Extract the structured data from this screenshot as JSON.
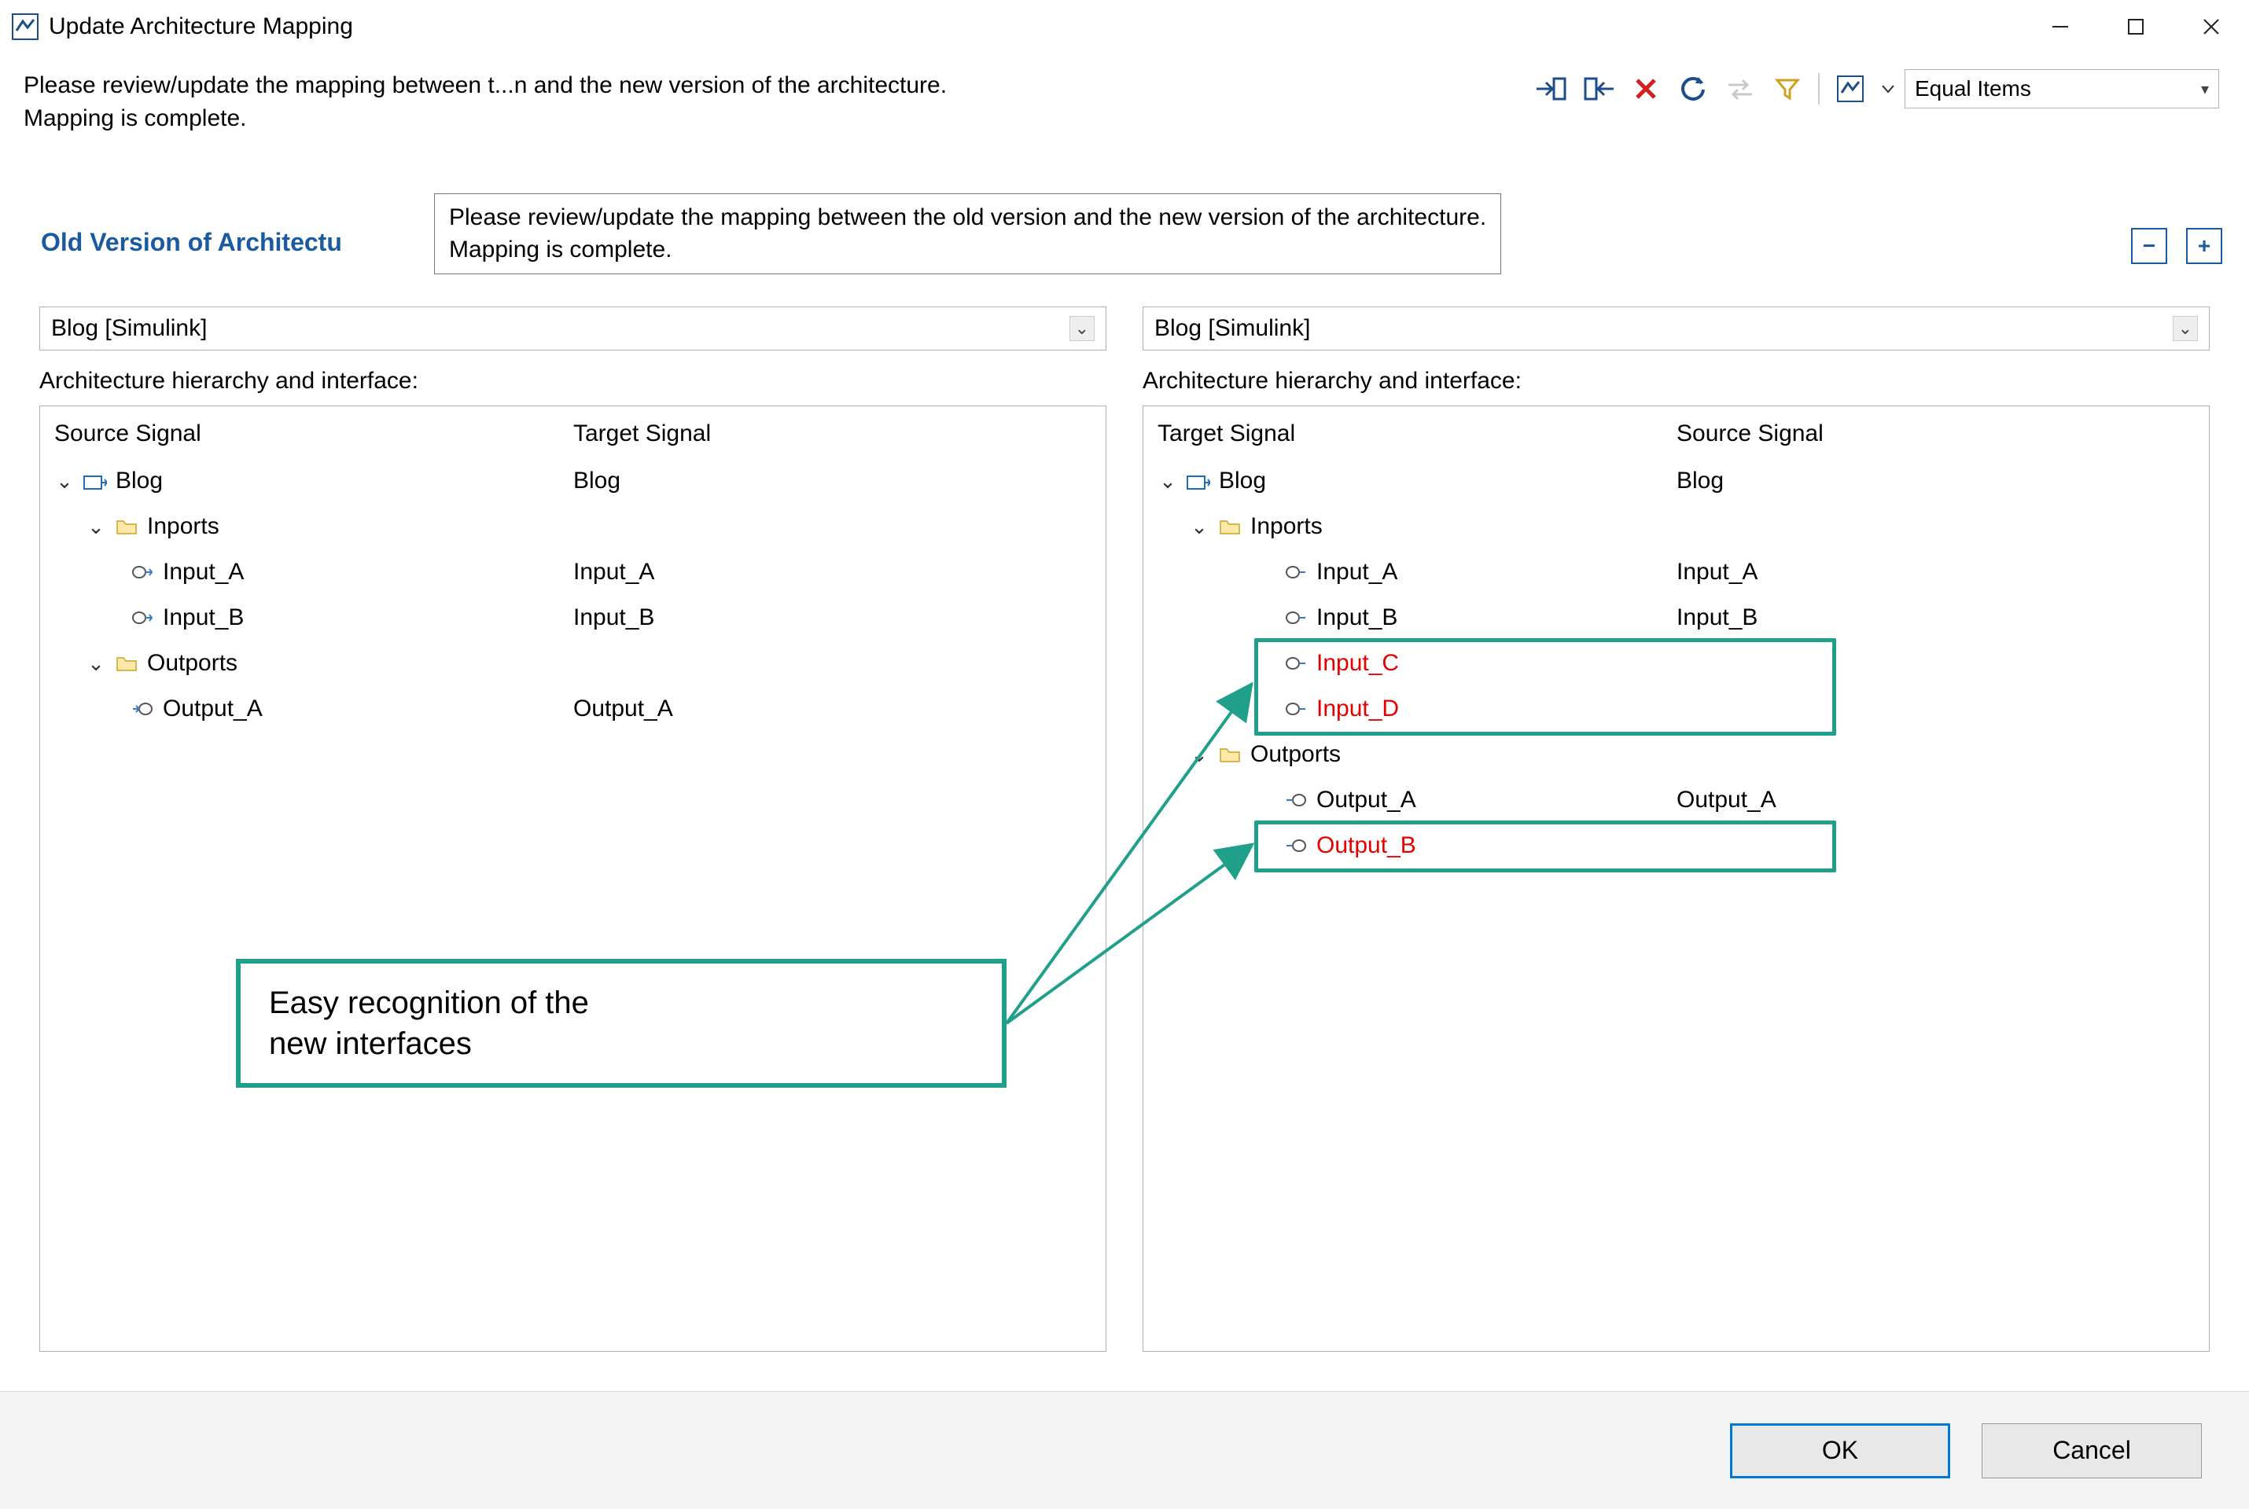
{
  "window": {
    "title": "Update Architecture Mapping"
  },
  "message": {
    "line1": "Please review/update the mapping between t...n and the new version of the architecture.",
    "line2": "Mapping is complete."
  },
  "tooltip": {
    "line1": "Please review/update the mapping between the old version and the new version of the architecture.",
    "line2": "Mapping is complete."
  },
  "toolbar": {
    "filter_label": "Equal Items"
  },
  "section": {
    "old_header": "Old Version of Architectu"
  },
  "left": {
    "combo": "Blog [Simulink]",
    "panel_label": "Architecture hierarchy and interface:",
    "col1": "Source Signal",
    "col2": "Target Signal",
    "root": {
      "name": "Blog",
      "target": "Blog"
    },
    "inports_label": "Inports",
    "inports": [
      {
        "name": "Input_A",
        "target": "Input_A"
      },
      {
        "name": "Input_B",
        "target": "Input_B"
      }
    ],
    "outports_label": "Outports",
    "outports": [
      {
        "name": "Output_A",
        "target": "Output_A"
      }
    ]
  },
  "right": {
    "combo": "Blog [Simulink]",
    "panel_label": "Architecture hierarchy and interface:",
    "col1": "Target Signal",
    "col2": "Source Signal",
    "root": {
      "name": "Blog",
      "target": "Blog"
    },
    "inports_label": "Inports",
    "inports": [
      {
        "name": "Input_A",
        "target": "Input_A",
        "new": false
      },
      {
        "name": "Input_B",
        "target": "Input_B",
        "new": false
      },
      {
        "name": "Input_C",
        "target": "",
        "new": true
      },
      {
        "name": "Input_D",
        "target": "",
        "new": true
      }
    ],
    "outports_label": "Outports",
    "outports": [
      {
        "name": "Output_A",
        "target": "Output_A",
        "new": false
      },
      {
        "name": "Output_B",
        "target": "",
        "new": true
      }
    ]
  },
  "annotation": {
    "line1": "Easy recognition of the",
    "line2": "new interfaces"
  },
  "buttons": {
    "ok": "OK",
    "cancel": "Cancel"
  }
}
